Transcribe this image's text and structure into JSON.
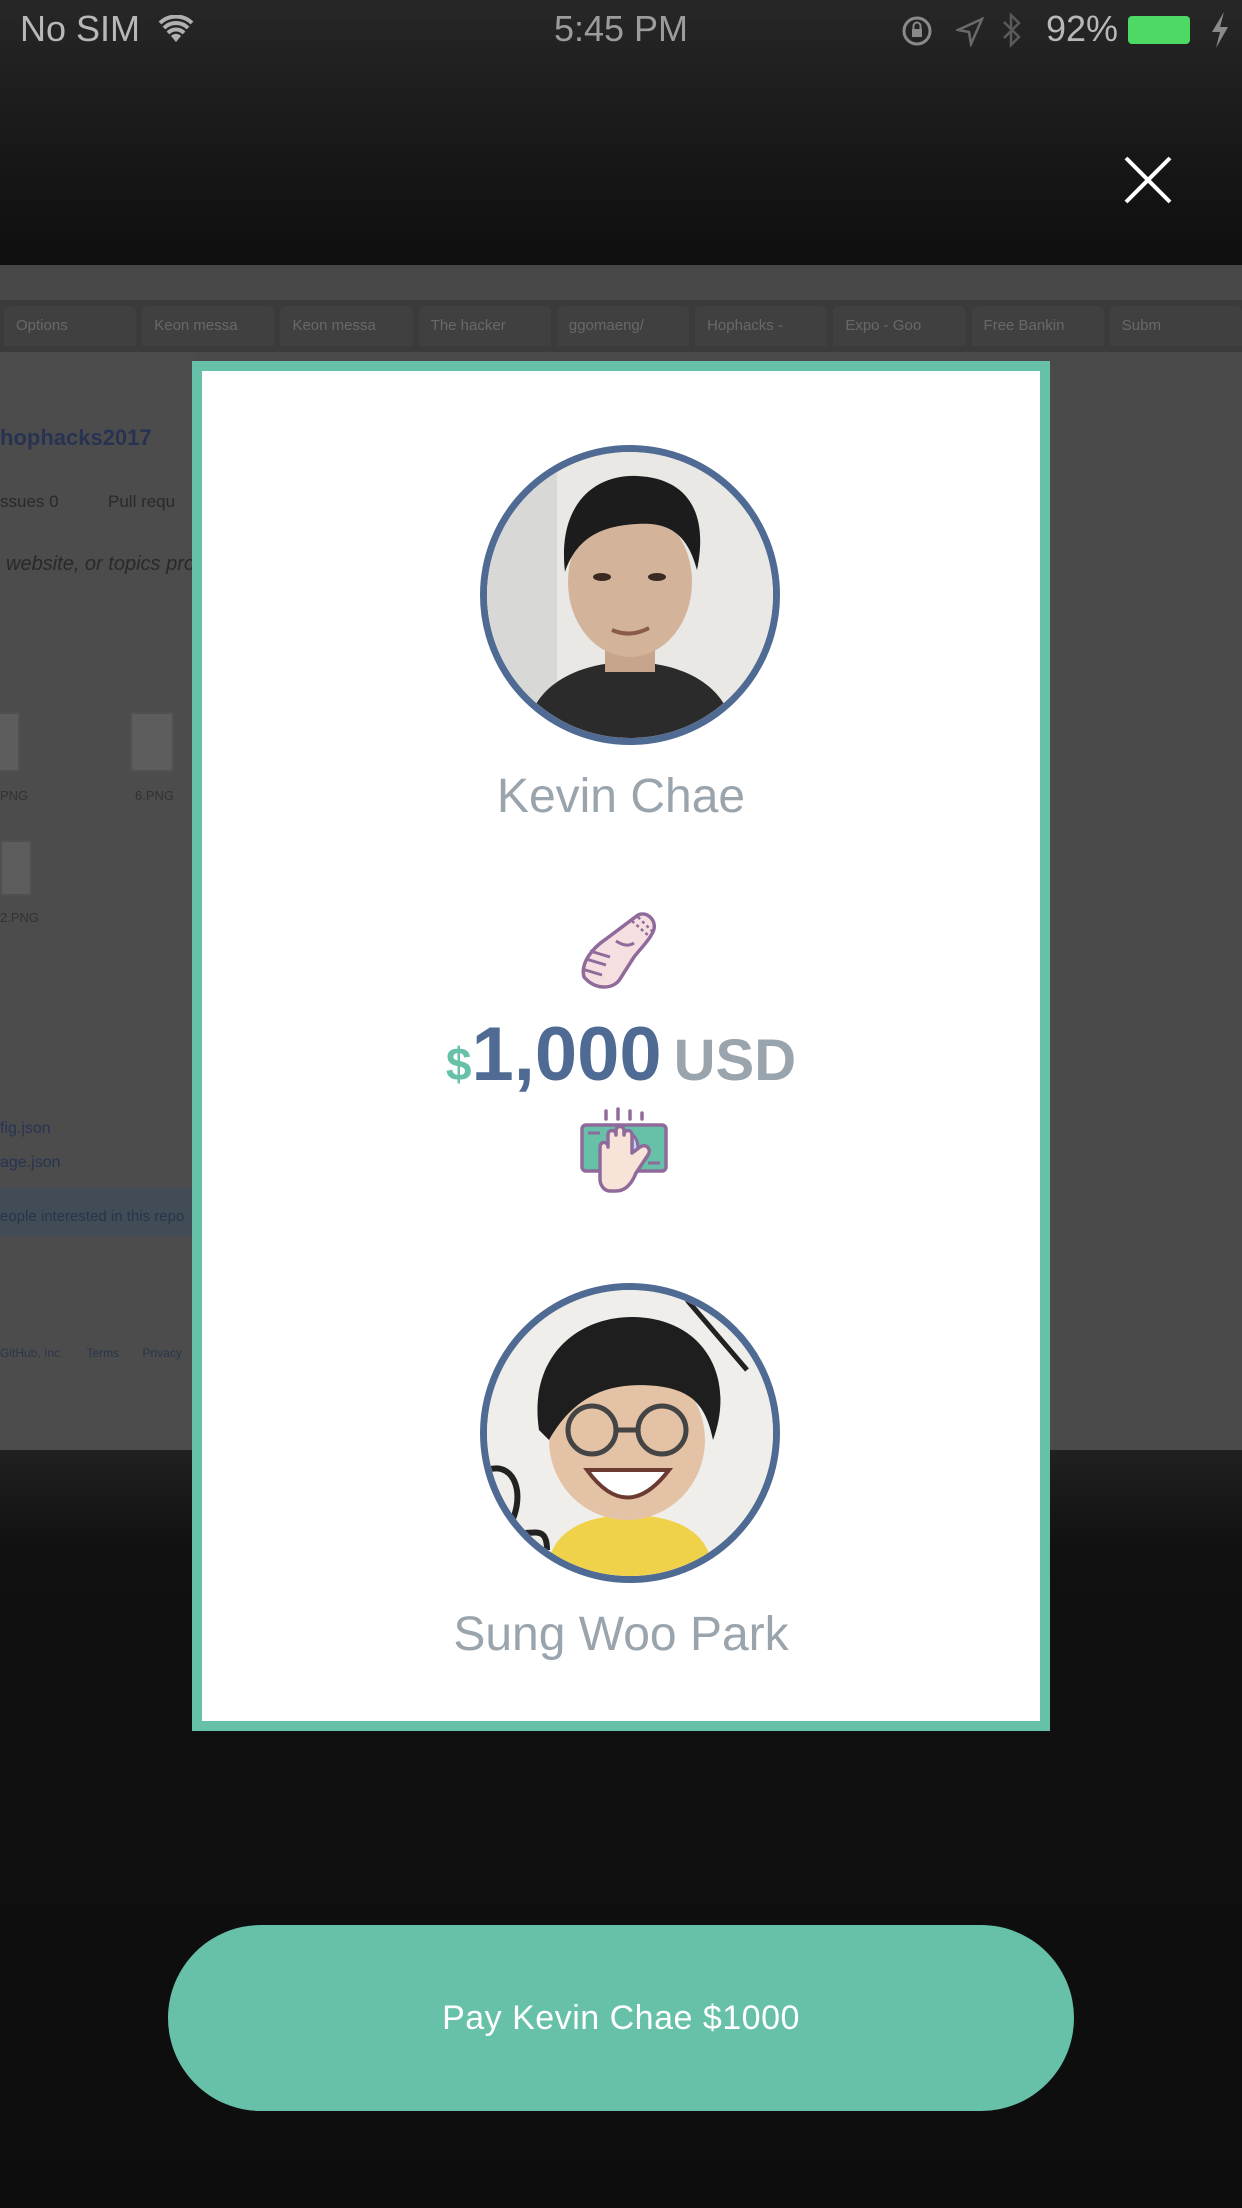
{
  "status_bar": {
    "carrier": "No SIM",
    "time": "5:45 PM",
    "battery_percent": "92%",
    "battery_level": 0.92,
    "icons": [
      "wifi-icon",
      "orientation-lock-icon",
      "location-icon",
      "bluetooth-icon",
      "battery-icon",
      "charging-icon"
    ]
  },
  "background": {
    "tabs": [
      "Options",
      "Keon messa",
      "Keon messa",
      "The hacker",
      "ggomaeng/",
      "Hophacks -",
      "Expo - Goo",
      "Free Bankin",
      "Subm"
    ],
    "repo_title": "hophacks2017",
    "issues_label": "ssues",
    "issues_count": "0",
    "pulls_label": "Pull requ",
    "description": "website, or topics pro",
    "files": [
      "PNG",
      "6.PNG",
      "2.PNG"
    ],
    "json_files": [
      "fig.json",
      "age.json"
    ],
    "banner_text": "eople interested in this repo",
    "footer": [
      "GitHub, Inc.",
      "Terms",
      "Privacy"
    ]
  },
  "close_button": {
    "icon": "close-icon"
  },
  "payment": {
    "payee_name": "Kevin Chae",
    "payer_name": "Sung Woo Park",
    "currency_symbol": "$",
    "amount": "1,000",
    "currency_code": "USD",
    "icons": {
      "top": "handshake-icon",
      "bottom": "money-in-hand-icon"
    }
  },
  "pay_button": {
    "label": "Pay Kevin Chae $1000"
  },
  "colors": {
    "accent": "#66c1a8",
    "navy": "#4f6b93",
    "muted_text": "#9aa4ad",
    "battery": "#4cd964"
  }
}
